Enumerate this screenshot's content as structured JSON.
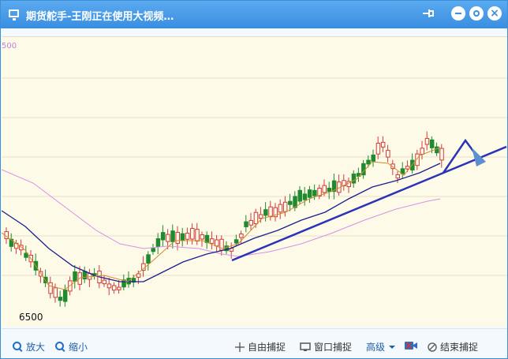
{
  "window": {
    "title": "期货舵手-王刚正在使用大视频…",
    "buttons": {
      "pin": "pin",
      "minimize": "minimize",
      "maximize": "maximize",
      "close": "×"
    }
  },
  "chart": {
    "top_price_label": "500",
    "low_price_label": "6500",
    "colors": {
      "up_candle": "#d23b3b",
      "down_candle": "#1f8a2e",
      "ma_short": "#d18b2f",
      "ma_mid": "#1a1f8f",
      "ma_long": "#d690e8",
      "trendline": "#2b33b8",
      "background": "#fdfbe8"
    }
  },
  "toolbar": {
    "zoom_in": "放大",
    "zoom_out": "缩小",
    "free_capture": "自由捕捉",
    "window_capture": "窗口捕捉",
    "advanced": "高级",
    "end_capture": "结束捕捉"
  },
  "icons": {
    "zoom_in": "magnifier-plus-icon",
    "zoom_out": "magnifier-minus-icon",
    "free_capture": "crosshair-icon",
    "window_capture": "window-icon",
    "record": "camera-icon",
    "end_capture": "stop-circle-icon"
  }
}
